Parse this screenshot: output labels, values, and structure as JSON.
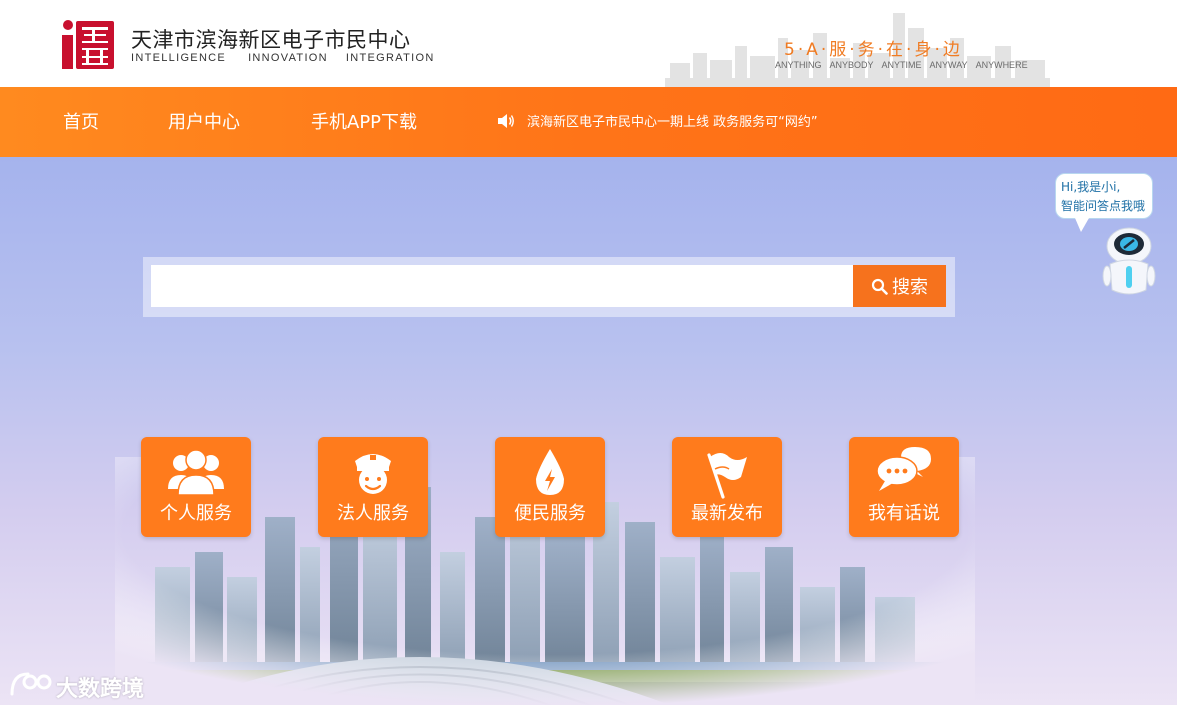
{
  "header": {
    "logo_text": "滨海",
    "title": "天津市滨海新区电子市民中心",
    "subtitle_words": [
      "INTELLIGENCE",
      "INNOVATION",
      "INTEGRATION"
    ],
    "slogan": "5·A·服·务·在·身·边",
    "slogan_words": [
      "ANYTHING",
      "ANYBODY",
      "ANYTIME",
      "ANYWAY",
      "ANYWHERE"
    ]
  },
  "nav": {
    "items": [
      {
        "label": "首页"
      },
      {
        "label": "用户中心"
      },
      {
        "label": "手机APP下载"
      }
    ],
    "notice": "滨海新区电子市民中心一期上线 政务服务可“网约”"
  },
  "search": {
    "value": "",
    "placeholder": "",
    "button_label": "搜索"
  },
  "tiles": [
    {
      "label": "个人服务",
      "icon": "people-group-icon"
    },
    {
      "label": "法人服务",
      "icon": "officer-icon"
    },
    {
      "label": "便民服务",
      "icon": "drop-bolt-icon"
    },
    {
      "label": "最新发布",
      "icon": "flag-icon"
    },
    {
      "label": "我有话说",
      "icon": "chat-bubbles-icon"
    }
  ],
  "assistant": {
    "greeting_line1": "Hi,我是小i,",
    "greeting_line2": "智能问答点我哦"
  },
  "watermark": {
    "text": "大数跨境"
  },
  "colors": {
    "accent_orange": "#ff7418",
    "tile_orange": "#ff7b1c",
    "slogan_orange": "#f07b22",
    "background_blue": "#a5b3ed",
    "logo_red": "#c8102e"
  }
}
